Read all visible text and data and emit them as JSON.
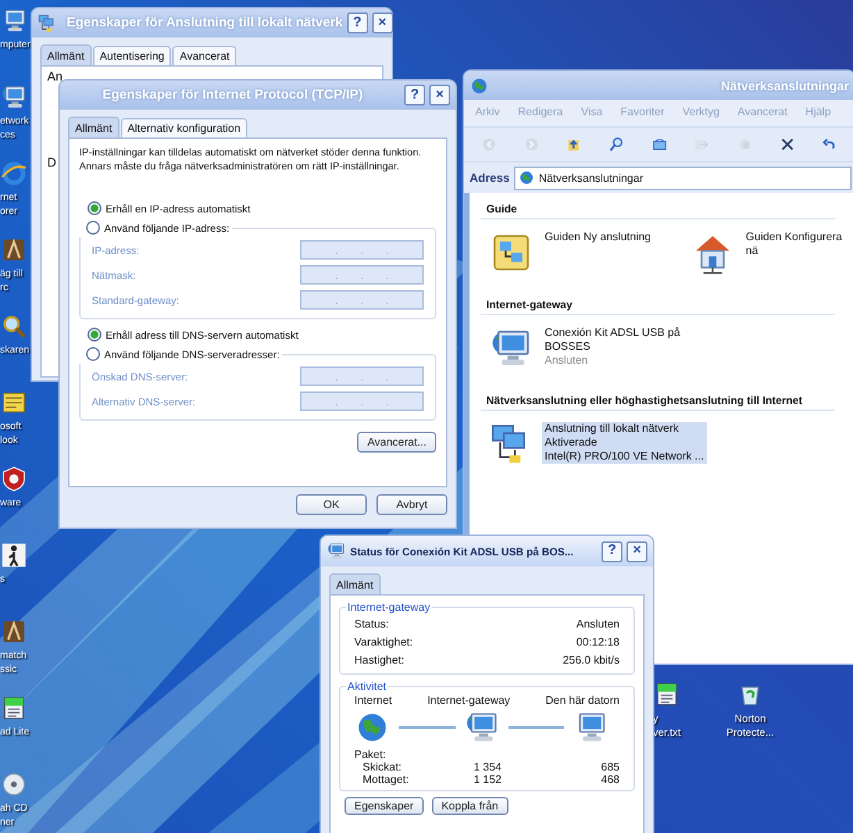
{
  "desktop": {
    "left_icons": [
      {
        "kind": "computer",
        "label": "mputer"
      },
      {
        "kind": "network",
        "label": "etwork\nces"
      },
      {
        "kind": "browser",
        "label": "rnet\norer"
      },
      {
        "kind": "game",
        "label": "äg till\nrc"
      },
      {
        "kind": "search",
        "label": "skaren"
      },
      {
        "kind": "mail",
        "label": "osoft\nlook"
      },
      {
        "kind": "shield",
        "label": "ware"
      },
      {
        "kind": "figure",
        "label": "s"
      },
      {
        "kind": "game",
        "label": "match\nssic"
      },
      {
        "kind": "note",
        "label": "ad Lite"
      },
      {
        "kind": "disc",
        "label": "ah CD\nner"
      }
    ],
    "right_icons": [
      {
        "kind": "note",
        "label": "y\nver.txt"
      },
      {
        "kind": "recycle",
        "label": "Norton\nProtecte..."
      }
    ]
  },
  "connection_properties": {
    "title": "Egenskaper för Anslutning till lokalt nätverk",
    "title_buttons": [
      "?",
      "×"
    ],
    "tabs": [
      {
        "label": "Allmänt",
        "selected": true
      },
      {
        "label": "Autentisering",
        "selected": false
      },
      {
        "label": "Avancerat",
        "selected": false
      }
    ],
    "texts": [
      "An",
      "D"
    ]
  },
  "tcpip_properties": {
    "title": "Egenskaper för Internet Protocol (TCP/IP)",
    "title_buttons": [
      "?",
      "×"
    ],
    "tabs": [
      {
        "label": "Allmänt",
        "selected": true
      },
      {
        "label": "Alternativ konfiguration",
        "selected": false
      }
    ],
    "description": "IP-inställningar kan tilldelas automatiskt om nätverket stöder denna funktion. Annars måste du fråga nätverksadministratören om rätt IP-inställningar.",
    "ip_options": [
      {
        "label": "Erhåll en IP-adress automatiskt",
        "selected": true
      },
      {
        "label": "Använd följande IP-adress:",
        "selected": false
      }
    ],
    "ip_fields": [
      {
        "label": "IP-adress:",
        "value": ". . .",
        "disabled": true
      },
      {
        "label": "Nätmask:",
        "value": ". . .",
        "disabled": true
      },
      {
        "label": "Standard-gateway:",
        "value": ". . .",
        "disabled": true
      }
    ],
    "dns_options": [
      {
        "label": "Erhåll adress till DNS-servern automatiskt",
        "selected": true
      },
      {
        "label": "Använd följande DNS-serveradresser:",
        "selected": false
      }
    ],
    "dns_fields": [
      {
        "label": "Önskad DNS-server:",
        "value": ". . .",
        "disabled": true
      },
      {
        "label": "Alternativ DNS-server:",
        "value": ". . .",
        "disabled": true
      }
    ],
    "advanced_button": "Avancerat...",
    "buttons": [
      "OK",
      "Avbryt"
    ]
  },
  "network_connections": {
    "title": "Nätverksanslutningar",
    "menu": [
      "Arkiv",
      "Redigera",
      "Visa",
      "Favoriter",
      "Verktyg",
      "Avancerat",
      "Hjälp"
    ],
    "toolbar": [
      {
        "kind": "back",
        "disabled": true
      },
      {
        "kind": "forward",
        "disabled": true
      },
      {
        "kind": "up",
        "disabled": false
      },
      {
        "kind": "search",
        "disabled": false
      },
      {
        "kind": "folders",
        "disabled": false
      },
      {
        "kind": "move",
        "disabled": true
      },
      {
        "kind": "copy",
        "disabled": true
      },
      {
        "kind": "delete",
        "disabled": false
      },
      {
        "kind": "undo",
        "disabled": false
      }
    ],
    "address_label": "Adress",
    "address": "Nätverksanslutningar",
    "groups": [
      {
        "heading": "Guide",
        "items": [
          {
            "kind": "wizard",
            "name": "Guiden Ny anslutning",
            "selected": false
          },
          {
            "kind": "home",
            "name": "Guiden Konfigurera nä",
            "selected": false
          }
        ]
      },
      {
        "heading": "Internet-gateway",
        "items": [
          {
            "kind": "gateway",
            "name": "Conexión Kit ADSL USB på BOSSES",
            "status": "Ansluten",
            "selected": false
          }
        ]
      },
      {
        "heading": "Nätverksanslutning eller höghastighetsanslutning till Internet",
        "items": [
          {
            "kind": "lan",
            "name": "Anslutning till lokalt nätverk",
            "status": "Aktiverade",
            "device": "Intel(R) PRO/100 VE Network ...",
            "selected": true
          }
        ]
      }
    ]
  },
  "status_dialog": {
    "title": "Status för Conexión Kit ADSL USB på BOS...",
    "title_buttons": [
      "?",
      "×"
    ],
    "tabs": [
      {
        "label": "Allmänt",
        "selected": true
      }
    ],
    "gateway_group": {
      "legend": "Internet-gateway",
      "rows": [
        {
          "label": "Status:",
          "value": "Ansluten"
        },
        {
          "label": "Varaktighet:",
          "value": "00:12:18"
        },
        {
          "label": "Hastighet:",
          "value": "256.0 kbit/s"
        }
      ]
    },
    "activity_group": {
      "legend": "Aktivitet",
      "nodes": [
        {
          "kind": "globe",
          "label": "Internet"
        },
        {
          "kind": "gateway",
          "label": "Internet-gateway"
        },
        {
          "kind": "computer",
          "label": "Den här datorn"
        }
      ],
      "packets_label": "Paket:",
      "packet_rows": [
        {
          "label": "Skickat:",
          "values": [
            "1 354",
            "685"
          ]
        },
        {
          "label": "Mottaget:",
          "values": [
            "1 152",
            "468"
          ]
        }
      ]
    },
    "buttons": [
      "Egenskaper",
      "Koppla från"
    ]
  }
}
